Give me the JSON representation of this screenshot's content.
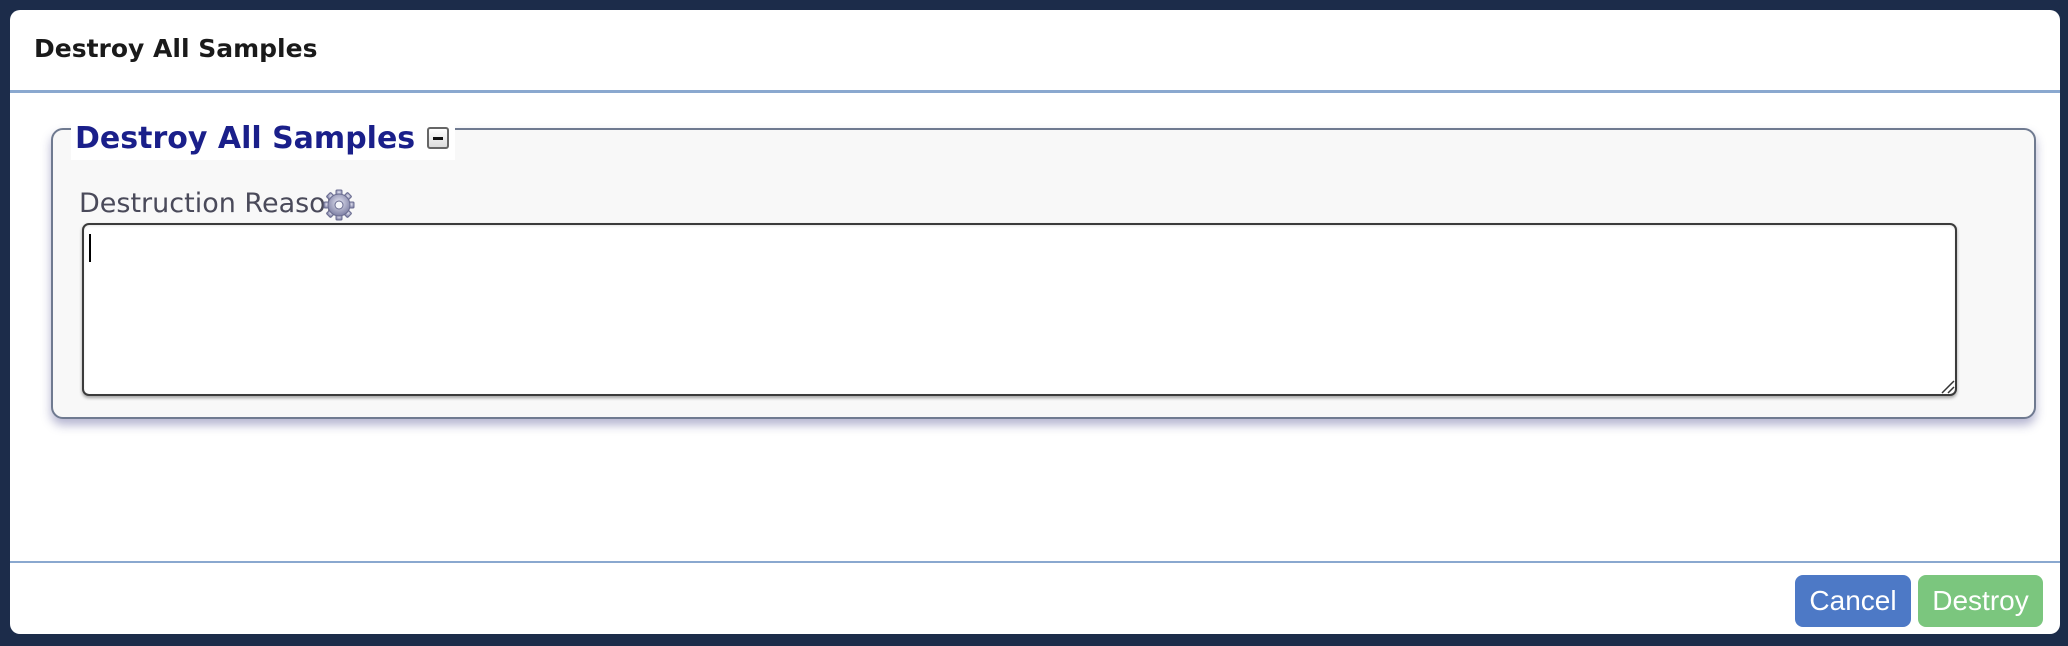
{
  "modal": {
    "title": "Destroy All Samples"
  },
  "fieldset": {
    "legend": "Destroy All Samples",
    "collapse_icon": "minus-box-icon"
  },
  "field": {
    "label": "Destruction Reason",
    "help_icon": "gear-icon",
    "value": "",
    "placeholder": ""
  },
  "footer": {
    "cancel_label": "Cancel",
    "destroy_label": "Destroy"
  },
  "colors": {
    "legend_text": "#1a1f8a",
    "cancel_button": "#4d79c6",
    "destroy_button": "#7bc67e",
    "divider": "#8aa8cf"
  }
}
